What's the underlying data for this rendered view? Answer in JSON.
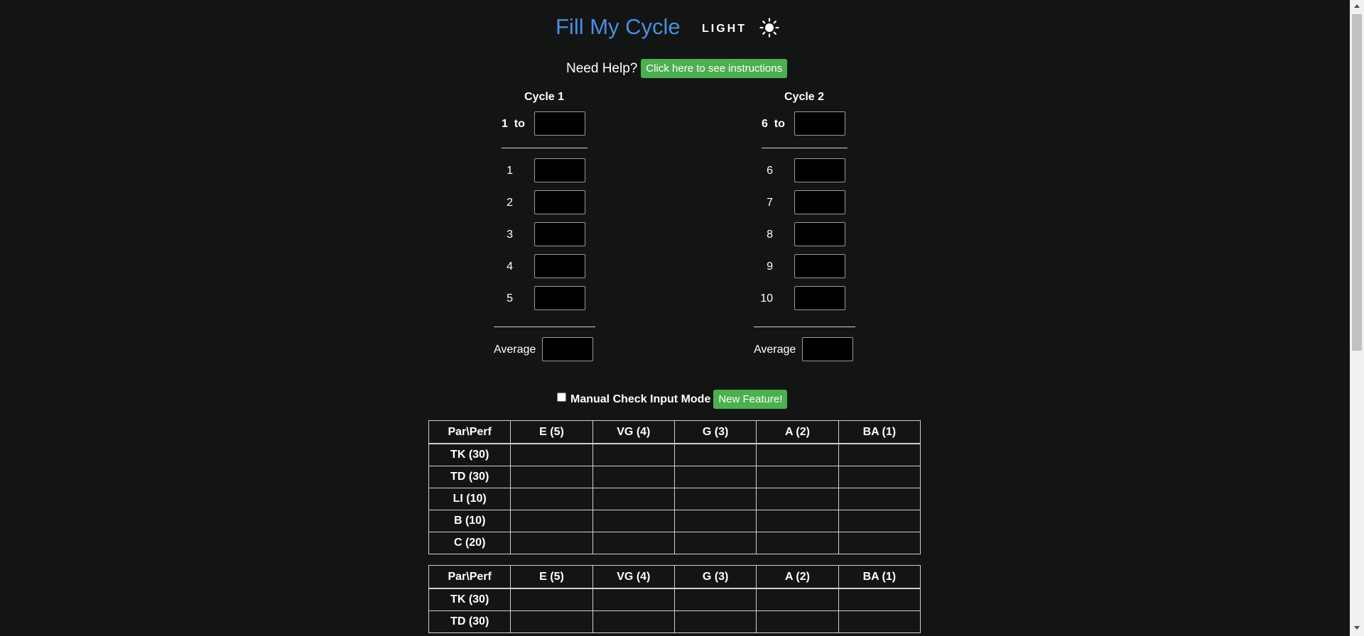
{
  "header": {
    "title": "Fill My Cycle",
    "theme_label": "LIGHT",
    "theme_icon": "sun-icon"
  },
  "help": {
    "text": "Need Help?",
    "button_label": "Click here to see instructions"
  },
  "cycles": [
    {
      "title": "Cycle 1",
      "range_label": "1  to",
      "rows": [
        "1",
        "2",
        "3",
        "4",
        "5"
      ],
      "average_label": "Average"
    },
    {
      "title": "Cycle 2",
      "range_label": "6  to",
      "rows": [
        "6",
        "7",
        "8",
        "9",
        "10"
      ],
      "average_label": "Average"
    }
  ],
  "manual": {
    "checked": false,
    "label": "Manual Check Input Mode",
    "badge": "New Feature!"
  },
  "tables": [
    {
      "headers": [
        "Par\\Perf",
        "E (5)",
        "VG (4)",
        "G (3)",
        "A (2)",
        "BA (1)"
      ],
      "rows": [
        "TK (30)",
        "TD (30)",
        "LI (10)",
        "B (10)",
        "C (20)"
      ]
    },
    {
      "headers": [
        "Par\\Perf",
        "E (5)",
        "VG (4)",
        "G (3)",
        "A (2)",
        "BA (1)"
      ],
      "rows": [
        "TK (30)",
        "TD (30)"
      ]
    }
  ],
  "colors": {
    "background": "#131514",
    "title": "#4a8de0",
    "button": "#4caf50"
  }
}
